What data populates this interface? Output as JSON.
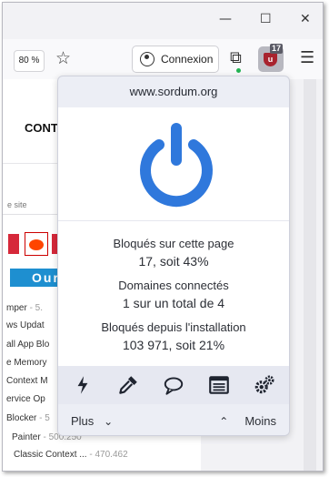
{
  "window": {
    "minimize_glyph": "—",
    "maximize_glyph": "☐",
    "close_glyph": "✕"
  },
  "toolbar": {
    "zoom_level": "80 %",
    "bookmark_icon": "star-icon",
    "sign_in_label": "Connexion",
    "extensions_icon": "puzzle-icon",
    "ublock_badge_count": "17",
    "menu_icon": "hamburger-menu-icon"
  },
  "webpage": {
    "heading_partial": "CONT",
    "search_hint_partial": "e site",
    "banner_partial": "Our",
    "list_items": [
      {
        "text": "mper",
        "meta": " - 5."
      },
      {
        "text": "ws Updat",
        "meta": ""
      },
      {
        "text": "all App Blo",
        "meta": ""
      },
      {
        "text": "e Memory",
        "meta": ""
      },
      {
        "text": "Context M",
        "meta": ""
      },
      {
        "text": "ervice Op",
        "meta": ""
      },
      {
        "text": "Blocker",
        "meta": " - 5"
      },
      {
        "text": "Painter",
        "meta": " - 500.250"
      },
      {
        "text": "Classic Context ...",
        "meta": " - 470.462"
      }
    ]
  },
  "popup": {
    "hostname": "www.sordum.org",
    "power_state": "on",
    "power_color": "#2f78dc",
    "stats": [
      {
        "label": "Bloqués sur cette page",
        "value": "17, soit 43%"
      },
      {
        "label": "Domaines connectés",
        "value": "1 sur un total de 4"
      },
      {
        "label": "Bloqués depuis l'installation",
        "value": "103 971, soit 21%"
      }
    ],
    "tools": [
      "lightning-icon",
      "eyedropper-icon",
      "chat-bubble-icon",
      "logger-list-icon",
      "settings-gears-icon"
    ],
    "more_label": "Plus",
    "less_label": "Moins"
  }
}
